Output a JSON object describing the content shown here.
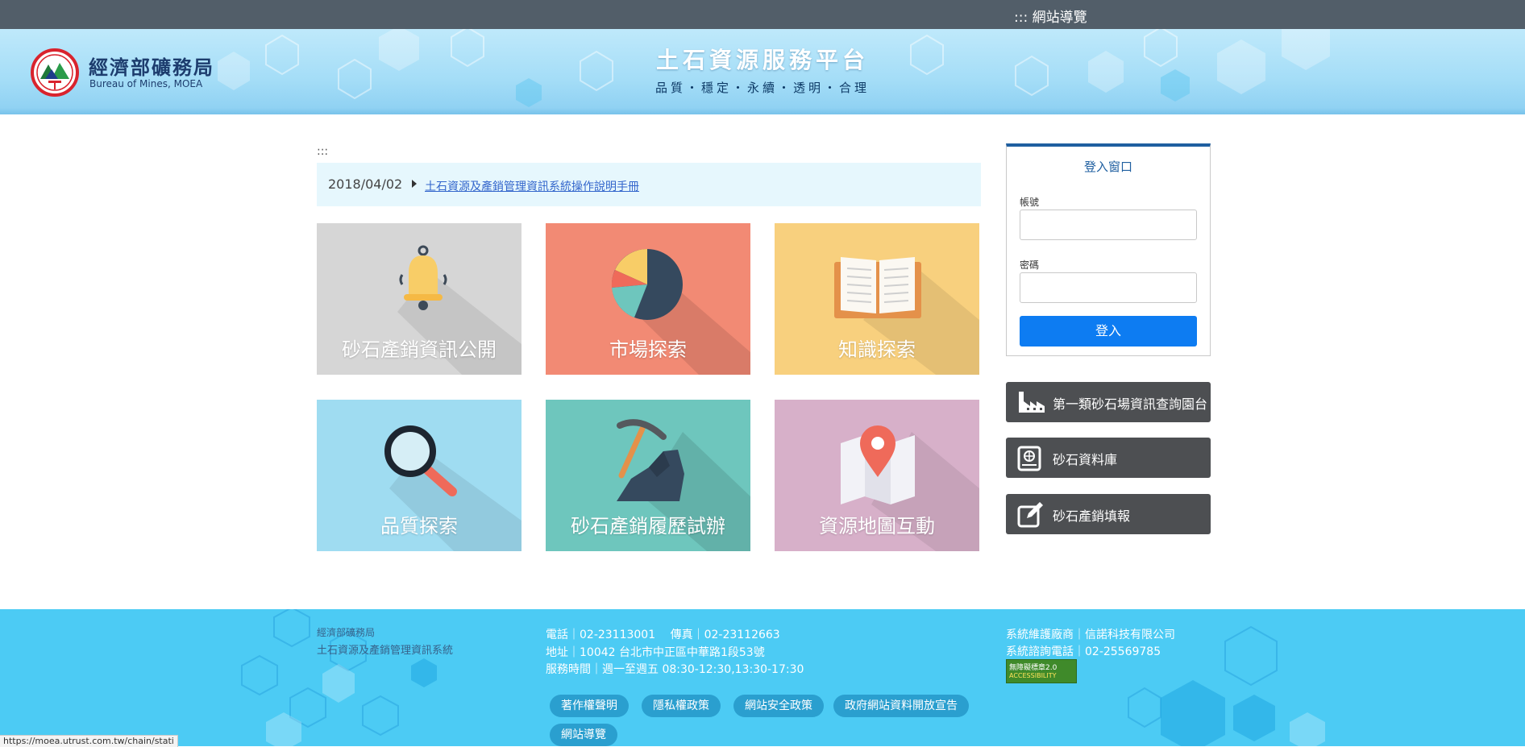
{
  "topbar": {
    "sitemap": "::: 網站導覽"
  },
  "header": {
    "org_zh": "經濟部礦務局",
    "org_en": "Bureau of Mines, MOEA",
    "title": "土石資源服務平台",
    "subtitle": "品質・穩定・永續・透明・合理"
  },
  "main": {
    "accesskey": ":::",
    "news": {
      "date": "2018/04/02",
      "link": "土石資源及產銷管理資訊系統操作說明手冊"
    },
    "tiles": [
      {
        "label": "砂石產銷資訊公開",
        "icon": "bell-icon",
        "color": "#d6d6d6"
      },
      {
        "label": "市場探索",
        "icon": "pie-chart-icon",
        "color": "#f28a74"
      },
      {
        "label": "知識探索",
        "icon": "open-book-icon",
        "color": "#f8d07e"
      },
      {
        "label": "品質探索",
        "icon": "magnifier-icon",
        "color": "#9fdcf1"
      },
      {
        "label": "砂石產銷履歷試辦",
        "icon": "pickaxe-rock-icon",
        "color": "#6ec6bd"
      },
      {
        "label": "資源地圖互動",
        "icon": "map-pin-icon",
        "color": "#d7b0c9"
      }
    ]
  },
  "login": {
    "title": "登入窗口",
    "account_label": "帳號",
    "password_label": "密碼",
    "button": "登入"
  },
  "side_links": [
    {
      "label": "第一類砂石場資訊查詢園台",
      "icon": "factory-icon"
    },
    {
      "label": "砂石資料庫",
      "icon": "database-book-icon"
    },
    {
      "label": "砂石產銷填報",
      "icon": "edit-icon"
    }
  ],
  "footer": {
    "org": "經濟部礦務局",
    "system": "土石資源及產銷管理資訊系統",
    "phone": "電話｜02-23113001　 傳真｜02-23112663",
    "address": "地址｜10042 台北市中正區中華路1段53號",
    "hours": "服務時間｜週一至週五 08:30-12:30,13:30-17:30",
    "vendor": "系統維護廠商｜信諾科技有限公司",
    "consult": "系統諮詢電話｜02-25569785",
    "badge_top": "無障礙標章2.0",
    "badge_bottom": "ACCESSIBILITY",
    "links": [
      "著作權聲明",
      "隱私權政策",
      "網站安全政策",
      "政府網站資料開放宣告",
      "網站導覽"
    ]
  },
  "statusbar": "https://moea.utrust.com.tw/chain/stati"
}
